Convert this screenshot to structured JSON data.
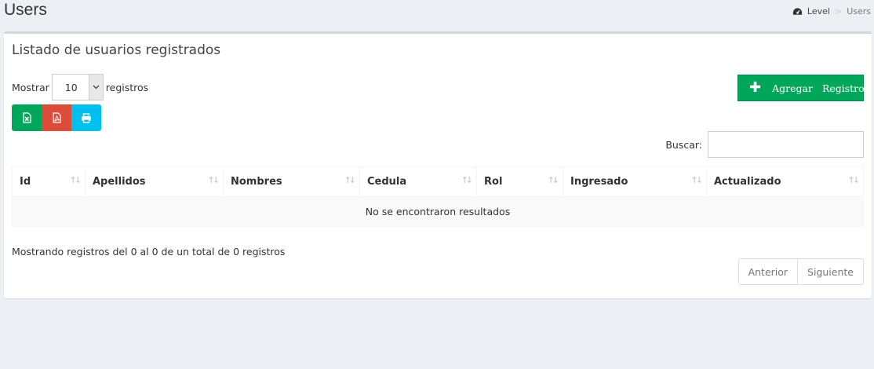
{
  "header": {
    "title": "Users",
    "breadcrumb": {
      "home_icon": "dashboard-icon",
      "home": "Level",
      "separator": ">",
      "current": "Users"
    }
  },
  "box": {
    "title": "Listado de usuarios registrados",
    "length": {
      "prefix": "Mostrar",
      "value": "10",
      "suffix": "registros"
    },
    "add_button": {
      "icon": "plus-icon",
      "word1": "Agregar",
      "word2": "Registro"
    },
    "export_buttons": [
      "excel-icon",
      "pdf-icon",
      "print-icon"
    ],
    "search": {
      "label": "Buscar:",
      "value": ""
    },
    "table": {
      "columns": [
        "Id",
        "Apellidos",
        "Nombres",
        "Cedula",
        "Rol",
        "Ingresado",
        "Actualizado"
      ],
      "empty_message": "No se encontraron resultados"
    },
    "info": "Mostrando registros del 0 al 0 de un total de 0 registros",
    "pagination": {
      "prev": "Anterior",
      "next": "Siguiente"
    }
  },
  "colors": {
    "background": "#ecf0f5",
    "success": "#00a65a",
    "danger": "#dd4b39",
    "info": "#00c0ef"
  }
}
